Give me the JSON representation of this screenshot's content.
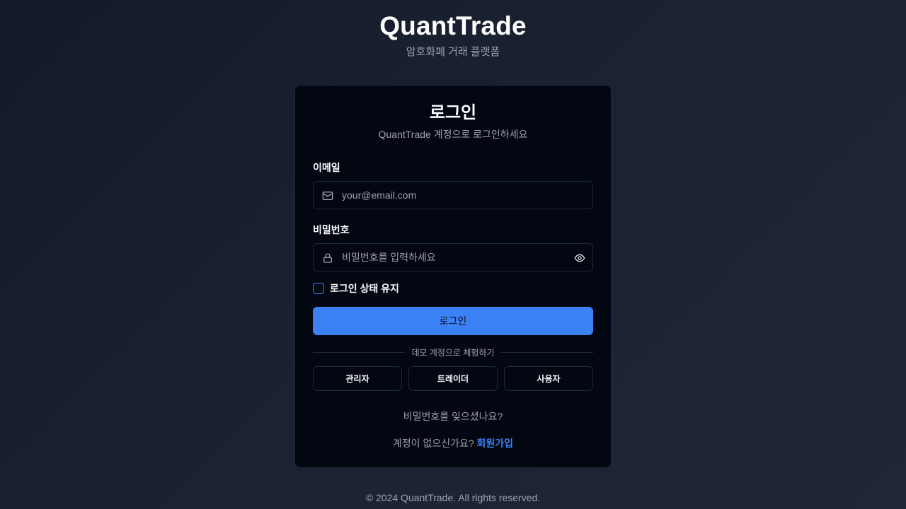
{
  "brand": {
    "title": "QuantTrade",
    "subtitle": "암호화폐 거래 플랫폼"
  },
  "card": {
    "title": "로그인",
    "description": "QuantTrade 계정으로 로그인하세요",
    "email": {
      "label": "이메일",
      "placeholder": "your@email.com",
      "value": "",
      "icon": "mail-icon"
    },
    "password": {
      "label": "비밀번호",
      "placeholder": "비밀번호를 입력하세요",
      "value": "",
      "icon": "lock-icon",
      "toggle_icon": "eye-icon"
    },
    "remember_label": "로그인 상태 유지",
    "remember_checked": false,
    "login_button": "로그인",
    "divider_text": "데모 계정으로 체험하기",
    "demo_accounts": [
      "관리자",
      "트레이더",
      "사용자"
    ],
    "forgot_password": "비밀번호를 잊으셨나요?",
    "signup_prompt": "계정이 없으신가요?",
    "signup_link": "회원가입"
  },
  "footer": {
    "copyright": "© 2024 QuantTrade. All rights reserved."
  },
  "colors": {
    "accent": "#3b82f6",
    "card_bg": "#030712",
    "border": "#1f2937",
    "muted_text": "#9ca3af"
  }
}
